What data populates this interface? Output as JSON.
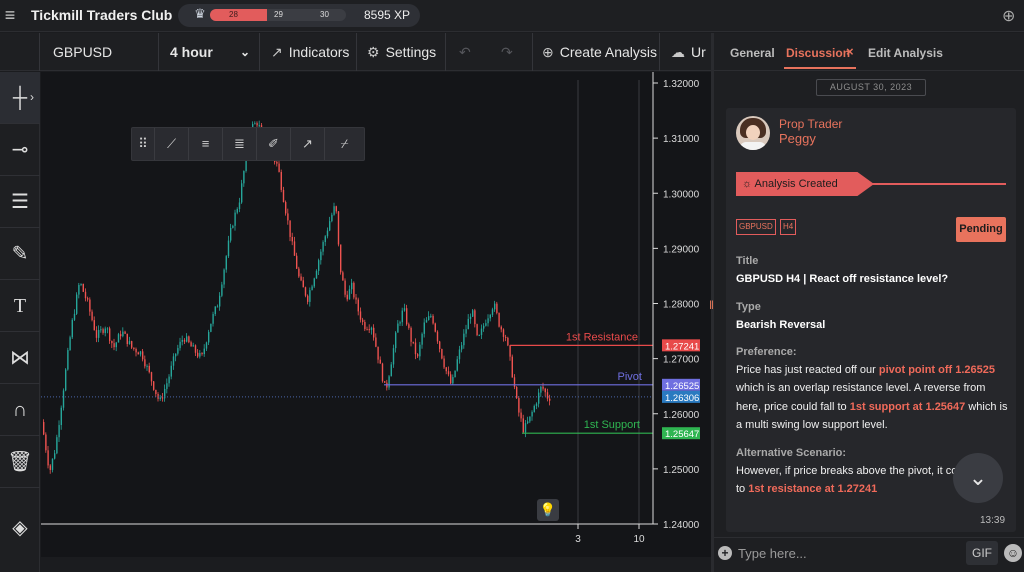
{
  "topbar": {
    "app_title": "Tickmill Traders Club",
    "xp": {
      "level_current": "28",
      "milestone_1": "29",
      "milestone_2": "30",
      "total": "8595 XP",
      "progress_fraction": 0.42
    }
  },
  "toolbar": {
    "symbol": "GBPUSD",
    "timeframe": "4 hour",
    "indicators": "Indicators",
    "settings": "Settings",
    "create_analysis": "Create Analysis",
    "upload_partial": "Ur"
  },
  "left_tools": [
    "crosshair-icon",
    "horizontal-ray-icon",
    "fib-lines-icon",
    "brush-icon",
    "text-icon",
    "pattern-icon",
    "magnet-icon",
    "trash-icon",
    "layers-icon"
  ],
  "chart": {
    "price_axis": [
      "1.32000",
      "1.31000",
      "1.30000",
      "1.29000",
      "1.28000",
      "1.27000",
      "1.26000",
      "1.25000",
      "1.24000"
    ],
    "time_axis": [
      "3",
      "10"
    ],
    "levels": [
      {
        "name": "1st Resistance",
        "value": "1.27241",
        "color": "#e84a4a"
      },
      {
        "name": "Pivot",
        "value": "1.26525",
        "color": "#6f6fe0"
      },
      {
        "name": "1st Support",
        "value": "1.25647",
        "color": "#2fb551"
      }
    ],
    "current_price": "1.26306"
  },
  "panel": {
    "tabs": {
      "general": "General",
      "discussion": "Discussion",
      "close": "×",
      "edit": "Edit Analysis"
    },
    "date": "AUGUST 30, 2023",
    "author_role": "Prop Trader",
    "author_name": "Peggy",
    "status": "Analysis Created",
    "tags": [
      "GBPUSD",
      "H4"
    ],
    "state": "Pending",
    "title_label": "Title",
    "title_value": "GBPUSD H4 | React off resistance level?",
    "type_label": "Type",
    "type_value": "Bearish Reversal",
    "preference_label": "Preference:",
    "preference": {
      "t1": "Price has just reacted off our ",
      "h1": "pivot point off 1.26525",
      "t2": " which is an overlap resistance level. A reverse from here, price could fall to ",
      "h2": "1st support at 1.25647",
      "t3": " which is a multi swing low support level."
    },
    "alt_label": "Alternative Scenario:",
    "alt": {
      "t1": "However, if price breaks above the pivot, it co",
      "t2": "to ",
      "h1": "1st resistance at 1.27241"
    },
    "time": "13:39",
    "input_placeholder": "Type here...",
    "gif": "GIF"
  }
}
